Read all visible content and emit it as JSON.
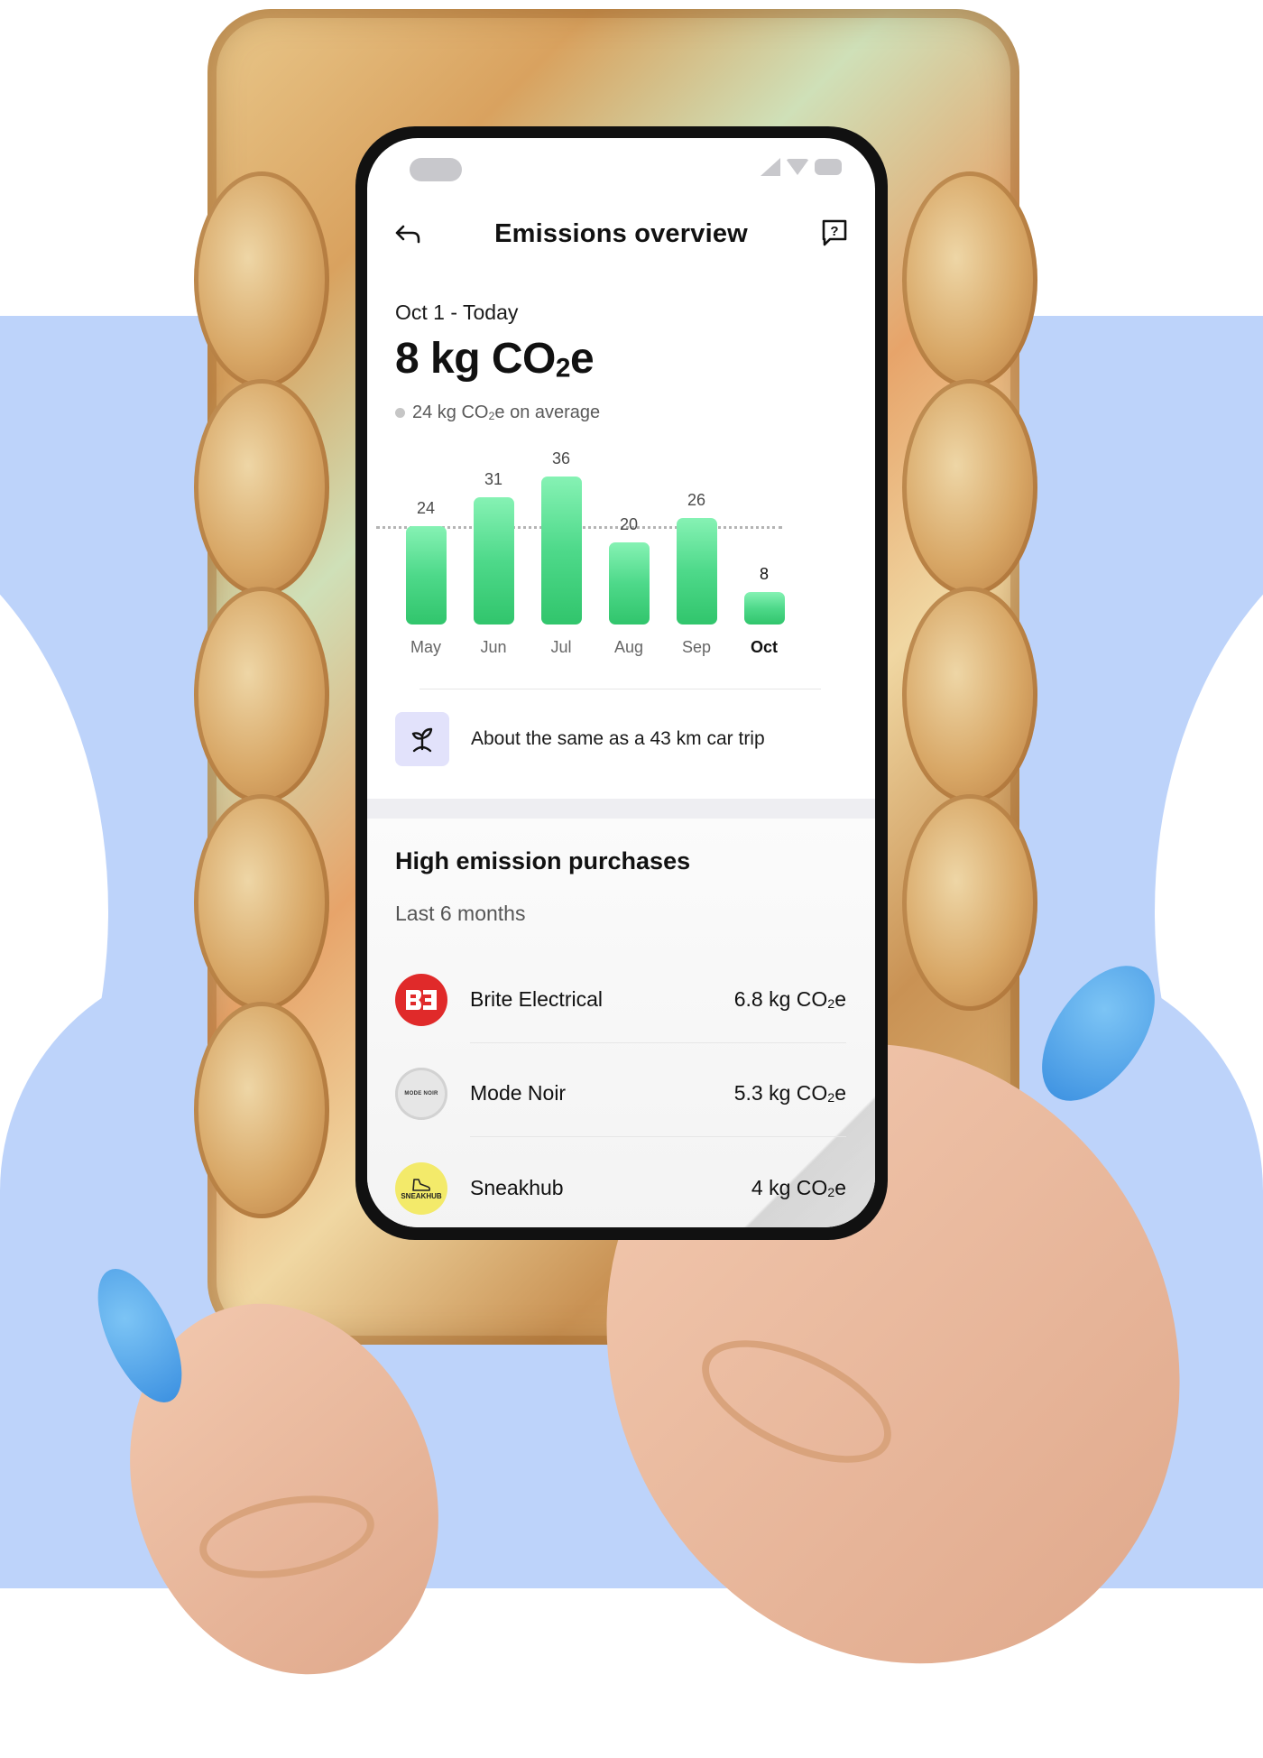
{
  "colors": {
    "background_blue": "#bdd3fa",
    "bar_green": "#4ed98a",
    "fact_icon_bg": "#e2e2fb",
    "brite_red": "#e02a2a",
    "sneakhub_yellow": "#f3ea6a"
  },
  "status_bar": {
    "icons": [
      "signal-icon",
      "wifi-icon",
      "battery-icon"
    ]
  },
  "header": {
    "back_icon": "back-arrow-icon",
    "title": "Emissions overview",
    "help_icon": "help-icon"
  },
  "summary": {
    "period": "Oct 1 - Today",
    "total_value": "8 kg CO",
    "total_sub": "2",
    "total_suffix": "e",
    "average_value": "24 kg CO",
    "average_sub": "2",
    "average_suffix": "e on average"
  },
  "chart_data": {
    "type": "bar",
    "title": "",
    "xlabel": "",
    "ylabel": "kg CO2e",
    "categories": [
      "May",
      "Jun",
      "Jul",
      "Aug",
      "Sep",
      "Oct"
    ],
    "values": [
      24,
      31,
      36,
      20,
      26,
      8
    ],
    "value_labels": [
      "24",
      "31",
      "36",
      "20",
      "26",
      "8"
    ],
    "highlighted_category": "Oct",
    "average_line": 24,
    "ylim": [
      0,
      36
    ],
    "grid": false,
    "legend": "none"
  },
  "fact": {
    "icon": "sprout-icon",
    "text": "About the same as a 43 km car trip"
  },
  "purchases": {
    "title": "High emission purchases",
    "subtitle": "Last 6 months",
    "items": [
      {
        "merchant": "Brite Electrical",
        "logo_text": "BE",
        "amount": "6.8 kg CO",
        "sub": "2",
        "suffix": "e"
      },
      {
        "merchant": "Mode Noir",
        "logo_text": "MODE NOIR",
        "amount": "5.3 kg CO",
        "sub": "2",
        "suffix": "e"
      },
      {
        "merchant": "Sneakhub",
        "logo_text": "SNEAKHUB",
        "amount": "4 kg CO",
        "sub": "2",
        "suffix": "e"
      }
    ]
  }
}
